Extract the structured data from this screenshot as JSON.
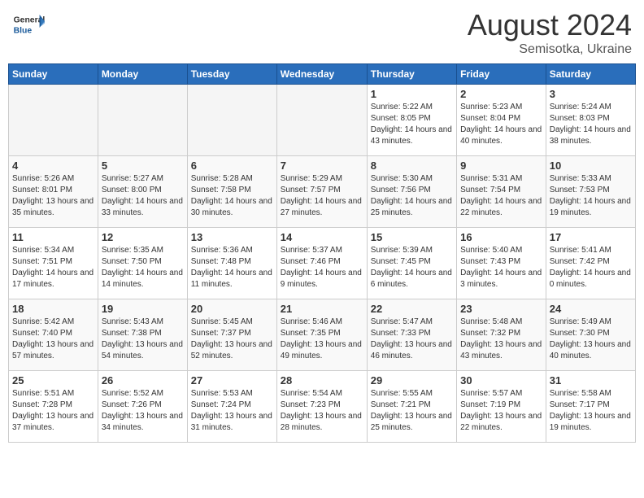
{
  "header": {
    "logo_general": "General",
    "logo_blue": "Blue",
    "main_title": "August 2024",
    "subtitle": "Semisotka, Ukraine"
  },
  "days_of_week": [
    "Sunday",
    "Monday",
    "Tuesday",
    "Wednesday",
    "Thursday",
    "Friday",
    "Saturday"
  ],
  "weeks": [
    [
      {
        "day": "",
        "empty": true
      },
      {
        "day": "",
        "empty": true
      },
      {
        "day": "",
        "empty": true
      },
      {
        "day": "",
        "empty": true
      },
      {
        "day": "1",
        "sunrise": "5:22 AM",
        "sunset": "8:05 PM",
        "daylight": "14 hours and 43 minutes."
      },
      {
        "day": "2",
        "sunrise": "5:23 AM",
        "sunset": "8:04 PM",
        "daylight": "14 hours and 40 minutes."
      },
      {
        "day": "3",
        "sunrise": "5:24 AM",
        "sunset": "8:03 PM",
        "daylight": "14 hours and 38 minutes."
      }
    ],
    [
      {
        "day": "4",
        "sunrise": "5:26 AM",
        "sunset": "8:01 PM",
        "daylight": "13 hours and 35 minutes."
      },
      {
        "day": "5",
        "sunrise": "5:27 AM",
        "sunset": "8:00 PM",
        "daylight": "14 hours and 33 minutes."
      },
      {
        "day": "6",
        "sunrise": "5:28 AM",
        "sunset": "7:58 PM",
        "daylight": "14 hours and 30 minutes."
      },
      {
        "day": "7",
        "sunrise": "5:29 AM",
        "sunset": "7:57 PM",
        "daylight": "14 hours and 27 minutes."
      },
      {
        "day": "8",
        "sunrise": "5:30 AM",
        "sunset": "7:56 PM",
        "daylight": "14 hours and 25 minutes."
      },
      {
        "day": "9",
        "sunrise": "5:31 AM",
        "sunset": "7:54 PM",
        "daylight": "14 hours and 22 minutes."
      },
      {
        "day": "10",
        "sunrise": "5:33 AM",
        "sunset": "7:53 PM",
        "daylight": "14 hours and 19 minutes."
      }
    ],
    [
      {
        "day": "11",
        "sunrise": "5:34 AM",
        "sunset": "7:51 PM",
        "daylight": "14 hours and 17 minutes."
      },
      {
        "day": "12",
        "sunrise": "5:35 AM",
        "sunset": "7:50 PM",
        "daylight": "14 hours and 14 minutes."
      },
      {
        "day": "13",
        "sunrise": "5:36 AM",
        "sunset": "7:48 PM",
        "daylight": "14 hours and 11 minutes."
      },
      {
        "day": "14",
        "sunrise": "5:37 AM",
        "sunset": "7:46 PM",
        "daylight": "14 hours and 9 minutes."
      },
      {
        "day": "15",
        "sunrise": "5:39 AM",
        "sunset": "7:45 PM",
        "daylight": "14 hours and 6 minutes."
      },
      {
        "day": "16",
        "sunrise": "5:40 AM",
        "sunset": "7:43 PM",
        "daylight": "14 hours and 3 minutes."
      },
      {
        "day": "17",
        "sunrise": "5:41 AM",
        "sunset": "7:42 PM",
        "daylight": "14 hours and 0 minutes."
      }
    ],
    [
      {
        "day": "18",
        "sunrise": "5:42 AM",
        "sunset": "7:40 PM",
        "daylight": "13 hours and 57 minutes."
      },
      {
        "day": "19",
        "sunrise": "5:43 AM",
        "sunset": "7:38 PM",
        "daylight": "13 hours and 54 minutes."
      },
      {
        "day": "20",
        "sunrise": "5:45 AM",
        "sunset": "7:37 PM",
        "daylight": "13 hours and 52 minutes."
      },
      {
        "day": "21",
        "sunrise": "5:46 AM",
        "sunset": "7:35 PM",
        "daylight": "13 hours and 49 minutes."
      },
      {
        "day": "22",
        "sunrise": "5:47 AM",
        "sunset": "7:33 PM",
        "daylight": "13 hours and 46 minutes."
      },
      {
        "day": "23",
        "sunrise": "5:48 AM",
        "sunset": "7:32 PM",
        "daylight": "13 hours and 43 minutes."
      },
      {
        "day": "24",
        "sunrise": "5:49 AM",
        "sunset": "7:30 PM",
        "daylight": "13 hours and 40 minutes."
      }
    ],
    [
      {
        "day": "25",
        "sunrise": "5:51 AM",
        "sunset": "7:28 PM",
        "daylight": "13 hours and 37 minutes."
      },
      {
        "day": "26",
        "sunrise": "5:52 AM",
        "sunset": "7:26 PM",
        "daylight": "13 hours and 34 minutes."
      },
      {
        "day": "27",
        "sunrise": "5:53 AM",
        "sunset": "7:24 PM",
        "daylight": "13 hours and 31 minutes."
      },
      {
        "day": "28",
        "sunrise": "5:54 AM",
        "sunset": "7:23 PM",
        "daylight": "13 hours and 28 minutes."
      },
      {
        "day": "29",
        "sunrise": "5:55 AM",
        "sunset": "7:21 PM",
        "daylight": "13 hours and 25 minutes."
      },
      {
        "day": "30",
        "sunrise": "5:57 AM",
        "sunset": "7:19 PM",
        "daylight": "13 hours and 22 minutes."
      },
      {
        "day": "31",
        "sunrise": "5:58 AM",
        "sunset": "7:17 PM",
        "daylight": "13 hours and 19 minutes."
      }
    ]
  ],
  "labels": {
    "sunrise_label": "Sunrise:",
    "sunset_label": "Sunset:",
    "daylight_label": "Daylight:"
  }
}
